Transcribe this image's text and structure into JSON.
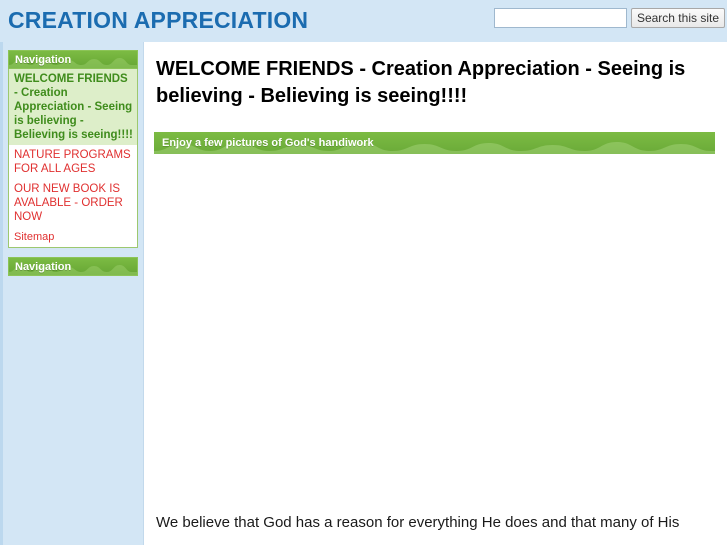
{
  "header": {
    "site_title": "CREATION APPRECIATION",
    "search": {
      "value": "",
      "placeholder": "",
      "button_label": "Search this site"
    }
  },
  "sidebar": {
    "blocks": [
      {
        "title": "Navigation",
        "items": [
          {
            "label": "WELCOME FRIENDS - Creation Appreciation - Seeing is believing - Believing is seeing!!!!",
            "active": true
          },
          {
            "label": "NATURE PROGRAMS FOR ALL AGES",
            "active": false
          },
          {
            "label": "OUR NEW BOOK IS AVALABLE - ORDER NOW",
            "active": false
          },
          {
            "label": "Sitemap",
            "active": false
          }
        ]
      },
      {
        "title": "Navigation",
        "items": []
      }
    ]
  },
  "main": {
    "page_heading": "WELCOME FRIENDS - Creation Appreciation - Seeing is believing - Believing is seeing!!!!",
    "banner_text": "Enjoy a few pictures of God's handiwork",
    "body_text": "We believe that God has a reason for everything He does and that many of His"
  },
  "colors": {
    "page_background": "#d3e6f5",
    "title_blue": "#1b6cb0",
    "banner_green": "#7cbb43",
    "link_red": "#e03030",
    "active_green_text": "#3f8c1c",
    "active_green_background": "#ddeec9",
    "content_white": "#ffffff"
  }
}
